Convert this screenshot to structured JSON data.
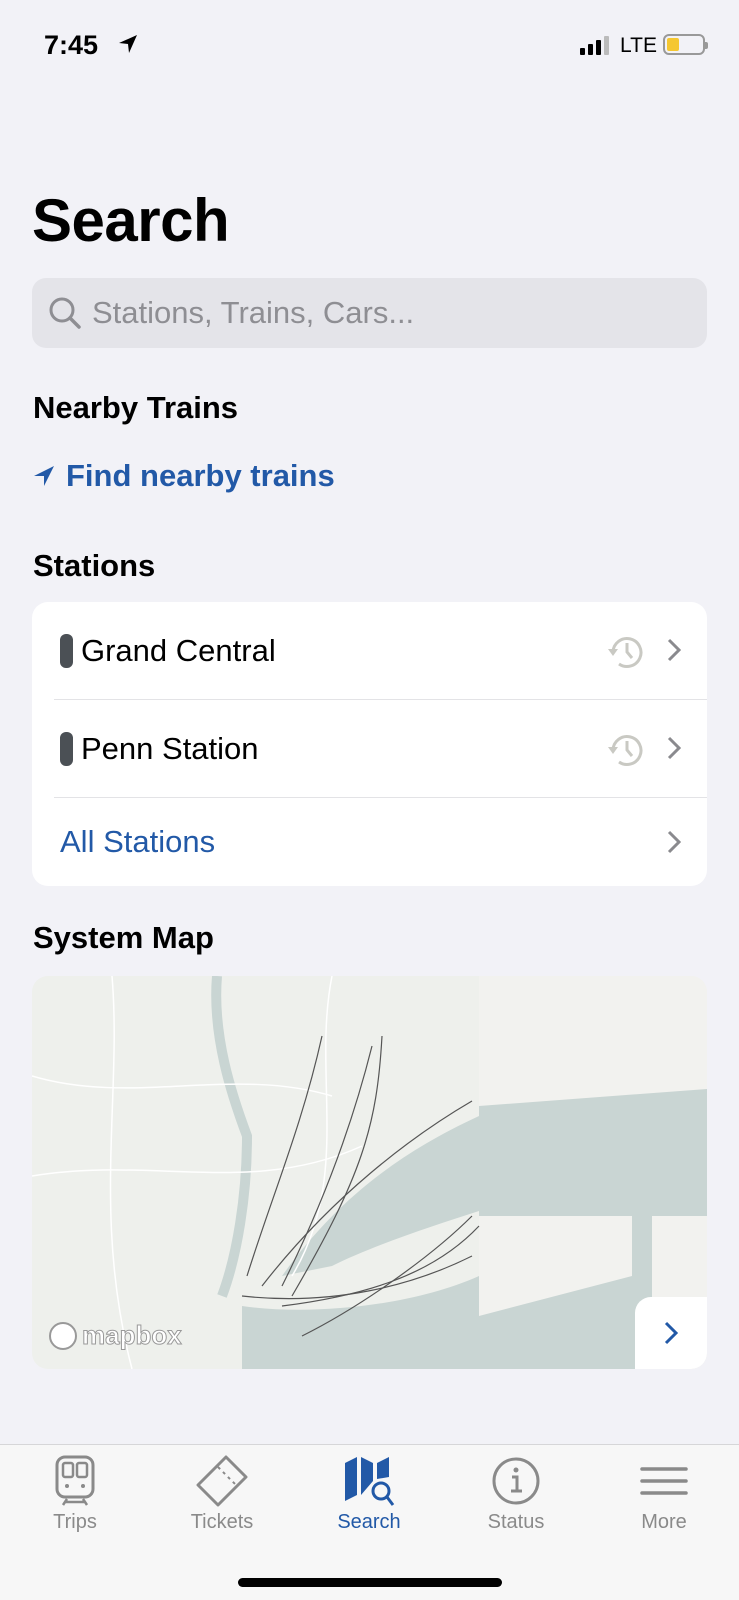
{
  "status_bar": {
    "time": "7:45",
    "network": "LTE",
    "battery_level": 0.35,
    "battery_color": "#f5c731"
  },
  "page_title": "Search",
  "search": {
    "placeholder": "Stations, Trains, Cars..."
  },
  "nearby": {
    "heading": "Nearby Trains",
    "link": "Find nearby trains"
  },
  "stations": {
    "heading": "Stations",
    "items": [
      {
        "label": "Grand Central",
        "icon": "history-icon"
      },
      {
        "label": "Penn Station",
        "icon": "history-icon"
      }
    ],
    "all_label": "All Stations"
  },
  "system_map": {
    "heading": "System Map",
    "attribution": "mapbox"
  },
  "tabs": [
    {
      "label": "Trips",
      "icon": "train-icon"
    },
    {
      "label": "Tickets",
      "icon": "ticket-icon"
    },
    {
      "label": "Search",
      "icon": "map-search-icon",
      "active": true
    },
    {
      "label": "Status",
      "icon": "info-icon"
    },
    {
      "label": "More",
      "icon": "menu-icon"
    }
  ],
  "colors": {
    "accent": "#2259a7",
    "background": "#f2f2f7"
  }
}
